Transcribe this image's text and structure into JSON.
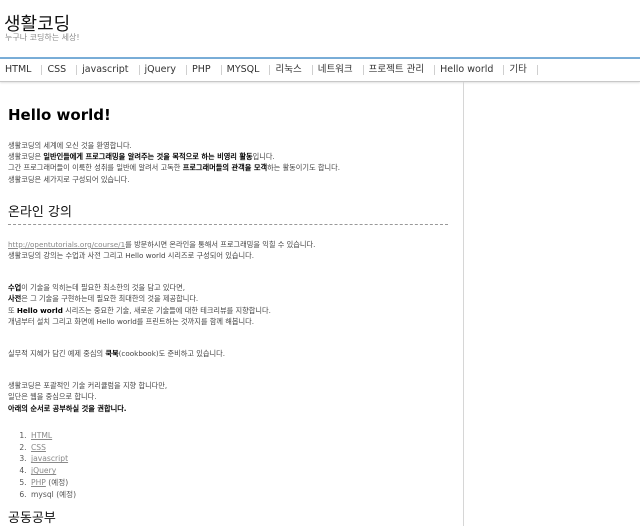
{
  "site": {
    "title": "생활코딩",
    "slogan": "누구나 코딩하는 세상!"
  },
  "nav": {
    "items": [
      "HTML",
      "CSS",
      "javascript",
      "jQuery",
      "PHP",
      "MYSQL",
      "리눅스",
      "네트워크",
      "프로젝트 관리",
      "Hello world",
      "기타"
    ]
  },
  "article": {
    "title": "Hello world!",
    "intro": {
      "line1": "생활코딩의 세계에 오신 것을 환영합니다.",
      "line2_pre": "생활코딩은 ",
      "line2_bold": "일반인들에게 프로그래밍을 알려주는 것을 목적으로 하는 비영리 활동",
      "line2_post": "입니다.",
      "line3_pre": "그간 프로그래머들이 이룩한 성취를 일반에 알려서 고독한 ",
      "line3_bold": "프로그래머들의 관객을 모객",
      "line3_post": "하는 활동이기도 합니다.",
      "line4": "생활코딩은 세가지로 구성되어 있습니다."
    },
    "online": {
      "heading": "온라인 강의",
      "link": "http://opentutorials.org/course/1",
      "link_suffix": "를 방문하시면 온라인을 통해서 프로그래밍을 익힐 수 있습니다.",
      "line2": "생활코딩의 강의는 수업과 사전 그리고 Hello world 시리즈로 구성되어 있습니다.",
      "p1_bold": "수업",
      "p1_rest": "이 기술을 익히는데 필요한 최소한의 것을 담고 있다면,",
      "p2_bold": "사전",
      "p2_rest": "은 그 기술을 구현하는데 필요한 최대한의 것을 제공합니다.",
      "p3_pre": "또 ",
      "p3_bold": "Hello world",
      "p3_rest": " 시리즈는 중요한 기술, 새로운 기술들에 대한 테크리뷰를 지향합니다.",
      "p4": "개념부터 설치 그리고 화면에 Hello world를 프린트하는 것까지를 함께 해봅니다.",
      "cookbook_pre": "실무적 지혜가 담긴 예제 중심의 ",
      "cookbook_bold": "쿡북",
      "cookbook_post": "(cookbook)도 준비하고 있습니다.",
      "c1": "생활코딩은 포괄적인 기술 커리큘럼을 지향 합니다만,",
      "c2": "일단은 웹을 중심으로 합니다.",
      "c3": "아래의 순서로 공부하실 것을 권합니다."
    },
    "toc": [
      {
        "label": "HTML",
        "suffix": ""
      },
      {
        "label": "CSS",
        "suffix": ""
      },
      {
        "label": "javascript",
        "suffix": ""
      },
      {
        "label": "jQuery",
        "suffix": ""
      },
      {
        "label": "PHP",
        "suffix": " (예정)"
      },
      {
        "label": "mysql",
        "suffix": " (예정)"
      }
    ],
    "next_heading": "공동공부"
  }
}
